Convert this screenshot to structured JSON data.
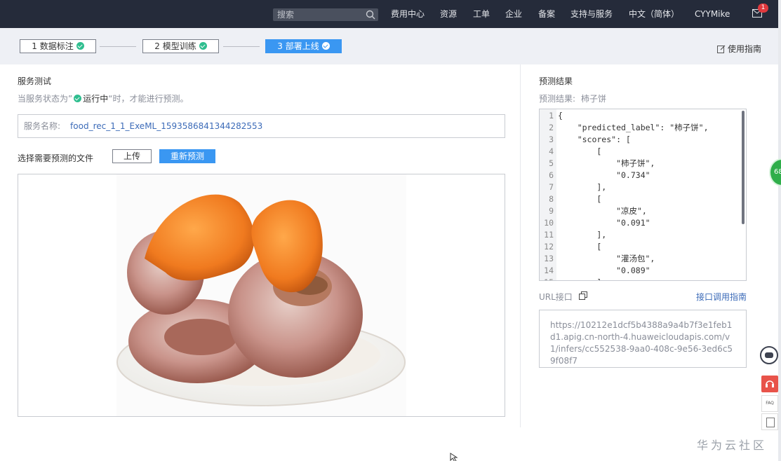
{
  "topbar": {
    "search_placeholder": "搜索",
    "nav": [
      "费用中心",
      "资源",
      "工单",
      "企业",
      "备案",
      "支持与服务",
      "中文（简体）",
      "CYYMike"
    ],
    "mail_badge": "1"
  },
  "steps": {
    "items": [
      "1 数据标注",
      "2 模型训练",
      "3 部署上线"
    ],
    "active_index": 2,
    "guide_label": "使用指南"
  },
  "service_test": {
    "title": "服务测试",
    "hint_prefix": "当服务状态为”",
    "hint_status": "运行中",
    "hint_suffix": "“时，才能进行预测。",
    "service_name_label": "服务名称:",
    "service_name_value": "food_rec_1_1_ExeML_1593586841344282553",
    "upload_prompt": "选择需要预测的文件",
    "upload_button": "上传",
    "repredict_button": "重新预测"
  },
  "prediction": {
    "title": "预测结果",
    "result_label": "预测结果:",
    "result_value": "柿子饼",
    "code_lines": [
      "{",
      "    \"predicted_label\": \"柿子饼\",",
      "    \"scores\": [",
      "        [",
      "            \"柿子饼\",",
      "            \"0.734\"",
      "        ],",
      "        [",
      "            \"凉皮\",",
      "            \"0.091\"",
      "        ],",
      "        [",
      "            \"灌汤包\",",
      "            \"0.089\"",
      "        ]"
    ],
    "url_title": "URL接口",
    "api_guide_link": "接口调用指南",
    "url_value": "https://10212e1dcf5b4388a9a4b7f3e1feb1d1.apig.cn-north-4.huaweicloudapis.com/v1/infers/cc552538-9aa0-408c-9e56-3ed6c59f08f7"
  },
  "widgets": {
    "green_float_text": "68",
    "faq_text": "FAQ"
  },
  "footer": {
    "watermark": "华为云社区"
  },
  "colors": {
    "topbar_bg": "#252b3a",
    "accent_blue": "#3a97f2",
    "success_green": "#2fbe8f",
    "link_blue": "#3c6bb8"
  }
}
